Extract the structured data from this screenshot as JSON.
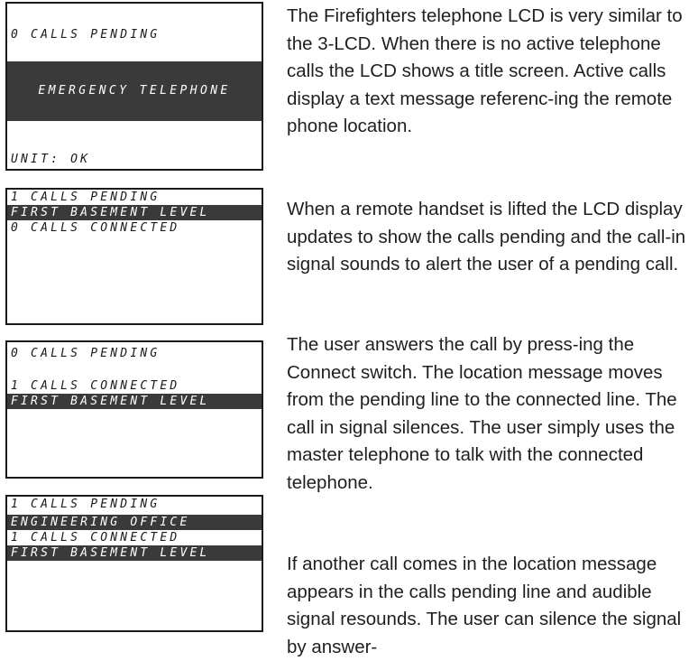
{
  "lcd1": {
    "top_line": "0 CALLS PENDING",
    "title": "EMERGENCY TELEPHONE",
    "bottom_line": "UNIT: OK"
  },
  "lcd2": {
    "line1": "1 CALLS PENDING",
    "line2": "FIRST BASEMENT LEVEL",
    "line3": "0 CALLS CONNECTED"
  },
  "lcd3": {
    "line1": "0 CALLS PENDING",
    "line2": "1 CALLS CONNECTED",
    "line3": "FIRST BASEMENT LEVEL"
  },
  "lcd4": {
    "line1": "1 CALLS PENDING",
    "line2": "ENGINEERING OFFICE",
    "line3": "1 CALLS CONNECTED",
    "line4": "FIRST BASEMENT LEVEL"
  },
  "paragraphs": [
    "The Firefighters telephone LCD is very similar to the 3-LCD. When there is no active telephone calls the LCD shows a title screen. Active calls display a text message referenc-ing the remote phone location.",
    "When a remote handset is lifted the LCD display updates to show the calls pending and the call-in signal sounds to alert the user of a pending call.",
    "The user answers the call by press-ing the Connect switch. The location message moves from the pending line to the connected line. The call in signal silences. The user simply uses the master telephone to talk with the connected telephone.",
    "If another call comes in the location message appears in the calls pending line and audible signal resounds. The user can silence the signal by answer-"
  ]
}
